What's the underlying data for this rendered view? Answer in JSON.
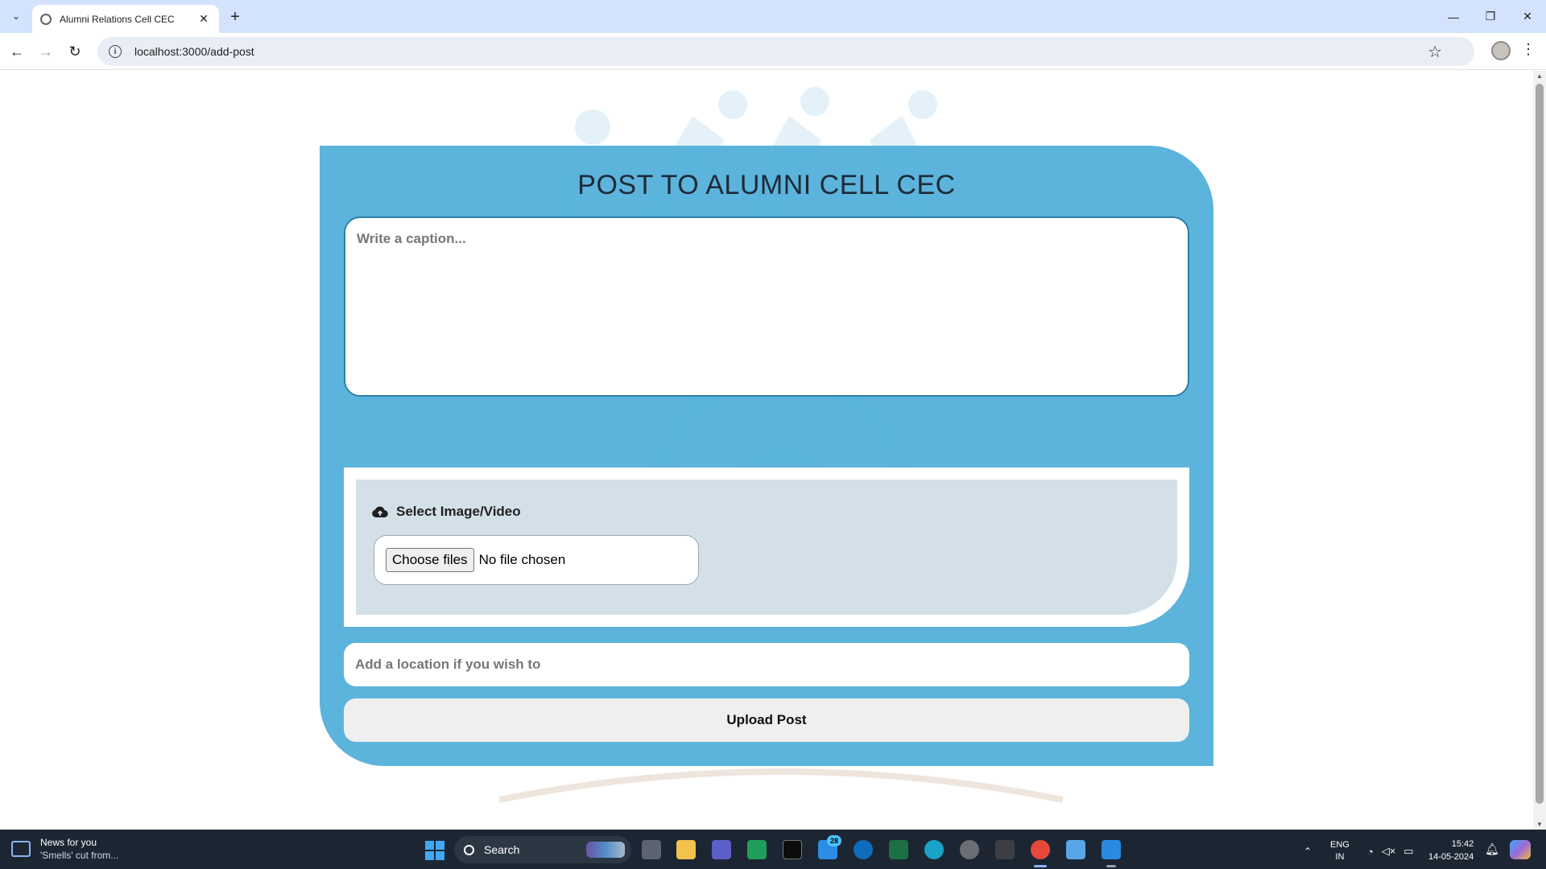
{
  "browser": {
    "tab_title": "Alumni Relations Cell CEC",
    "url": "localhost:3000/add-post",
    "close_tab": "✕",
    "new_tab": "+",
    "minimize": "—",
    "restore": "❐",
    "close_window": "✕"
  },
  "form": {
    "title": "POST TO ALUMNI CELL CEC",
    "caption_placeholder": "Write a caption...",
    "upload_label": "Select Image/Video",
    "choose_files_label": "Choose files",
    "no_file_text": "No file chosen",
    "location_placeholder": "Add a location if you wish to",
    "submit_label": "Upload Post"
  },
  "taskbar": {
    "news_title": "News for you",
    "news_subtitle": "'Smells' cut from...",
    "search_label": "Search",
    "mail_badge": "28",
    "lang_line1": "ENG",
    "lang_line2": "IN",
    "time": "15:42",
    "date": "14-05-2024"
  },
  "colors": {
    "card_blue": "#55b1db",
    "tab_bar": "#d3e3fd",
    "taskbar": "#1c2633",
    "upload_panel": "#d4e0e8"
  },
  "icons": [
    "tab-dropdown-icon",
    "globe-icon",
    "back-icon",
    "forward-icon",
    "reload-icon",
    "info-icon",
    "star-icon",
    "profile-icon",
    "menu-icon",
    "cloud-upload-icon",
    "windows-icon",
    "search-icon",
    "wifi-icon",
    "volume-icon",
    "battery-icon",
    "bell-icon"
  ]
}
